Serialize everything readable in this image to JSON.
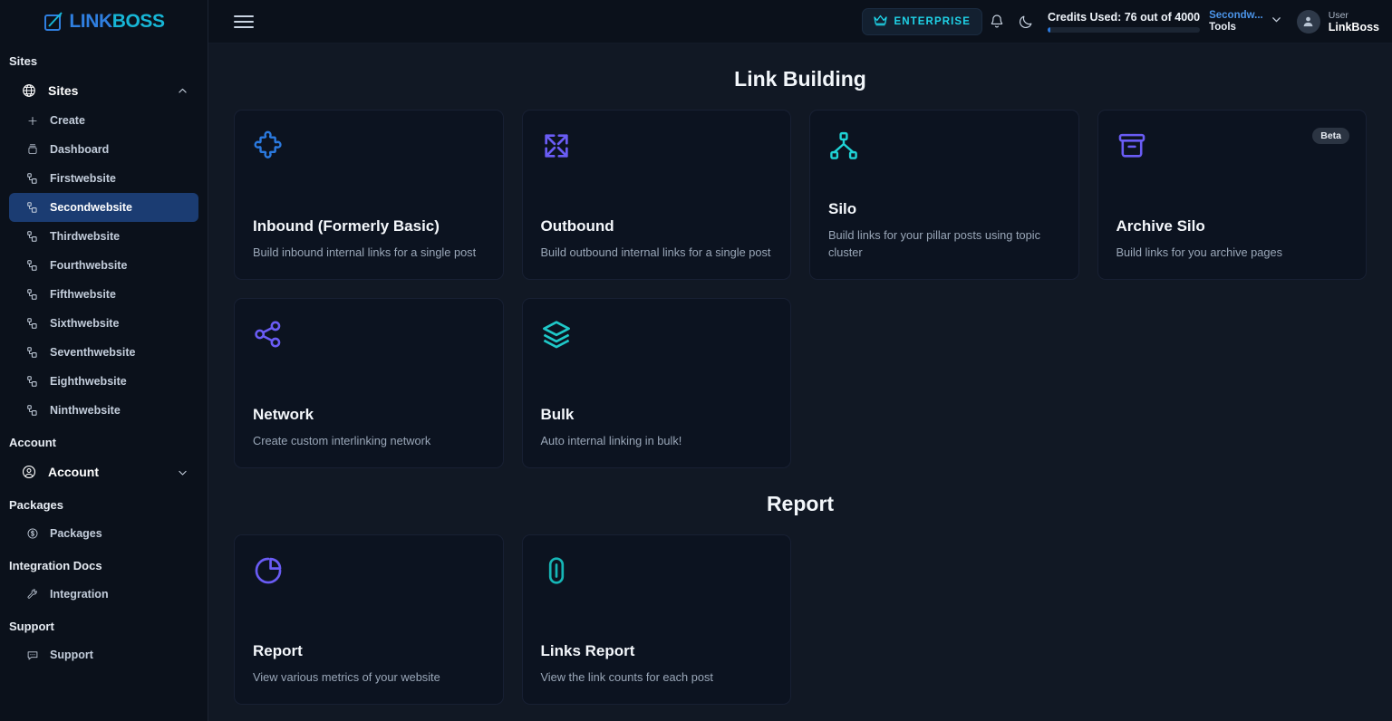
{
  "brand": {
    "name_part1": "LINK",
    "name_part2": "BOSS",
    "logo_icon": "linkboss-logo-icon"
  },
  "topbar": {
    "menu_icon": "hamburger-menu-icon",
    "enterprise_badge": {
      "label": "ENTERPRISE",
      "icon": "crown-icon",
      "color": "#1fd3e8"
    },
    "notification_icon": "bell-icon",
    "theme_icon": "moon-icon",
    "credits": {
      "label": "Credits Used: 76 out of 4000",
      "used": 76,
      "total": 4000,
      "percent": 1.9
    },
    "site_switcher": {
      "site": "Secondw...",
      "sub": "Tools",
      "chevron_icon": "chevron-down-icon"
    },
    "user": {
      "role": "User",
      "name": "LinkBoss",
      "avatar_icon": "user-avatar-icon"
    }
  },
  "sidebar": {
    "groups": [
      {
        "title": "Sites",
        "items": [
          {
            "label": "Sites",
            "icon": "globe-icon",
            "type": "parent",
            "expanded": true,
            "chevron": "chevron-up-icon"
          },
          {
            "label": "Create",
            "icon": "plus-icon",
            "type": "sub"
          },
          {
            "label": "Dashboard",
            "icon": "dashboard-icon",
            "type": "sub"
          },
          {
            "label": "Firstwebsite",
            "icon": "sitemap-icon",
            "type": "sub"
          },
          {
            "label": "Secondwebsite",
            "icon": "sitemap-icon",
            "type": "sub",
            "active": true
          },
          {
            "label": "Thirdwebsite",
            "icon": "sitemap-icon",
            "type": "sub"
          },
          {
            "label": "Fourthwebsite",
            "icon": "sitemap-icon",
            "type": "sub"
          },
          {
            "label": "Fifthwebsite",
            "icon": "sitemap-icon",
            "type": "sub"
          },
          {
            "label": "Sixthwebsite",
            "icon": "sitemap-icon",
            "type": "sub"
          },
          {
            "label": "Seventhwebsite",
            "icon": "sitemap-icon",
            "type": "sub"
          },
          {
            "label": "Eighthwebsite",
            "icon": "sitemap-icon",
            "type": "sub"
          },
          {
            "label": "Ninthwebsite",
            "icon": "sitemap-icon",
            "type": "sub"
          }
        ]
      },
      {
        "title": "Account",
        "items": [
          {
            "label": "Account",
            "icon": "user-circle-icon",
            "type": "parent",
            "expanded": false,
            "chevron": "chevron-down-icon"
          }
        ]
      },
      {
        "title": "Packages",
        "items": [
          {
            "label": "Packages",
            "icon": "dollar-circle-icon",
            "type": "sub"
          }
        ]
      },
      {
        "title": "Integration Docs",
        "items": [
          {
            "label": "Integration",
            "icon": "wrench-icon",
            "type": "sub"
          }
        ]
      },
      {
        "title": "Support",
        "items": [
          {
            "label": "Support",
            "icon": "chat-icon",
            "type": "sub"
          }
        ]
      }
    ]
  },
  "main": {
    "sections": [
      {
        "title": "Link Building",
        "cards": [
          {
            "title": "Inbound (Formerly Basic)",
            "desc": "Build inbound internal links for a single post",
            "icon": "puzzle-icon",
            "color": "#2b7ae0"
          },
          {
            "title": "Outbound",
            "desc": "Build outbound internal links for a single post",
            "icon": "expand-arrows-icon",
            "color": "#6a5cf5"
          },
          {
            "title": "Silo",
            "desc": "Build links for your pillar posts using topic cluster",
            "icon": "hierarchy-icon",
            "color": "#1fd3d6"
          },
          {
            "title": "Archive Silo",
            "desc": "Build links for you archive pages",
            "icon": "archive-box-icon",
            "color": "#6a5cf5",
            "badge": "Beta"
          },
          {
            "title": "Network",
            "desc": "Create custom interlinking network",
            "icon": "share-nodes-icon",
            "color": "#6a5cf5"
          },
          {
            "title": "Bulk",
            "desc": "Auto internal linking in bulk!",
            "icon": "layers-icon",
            "color": "#1fc8c8"
          }
        ]
      },
      {
        "title": "Report",
        "cards": [
          {
            "title": "Report",
            "desc": "View various metrics of your website",
            "icon": "pie-chart-icon",
            "color": "#6a5cf5"
          },
          {
            "title": "Links Report",
            "desc": "View the link counts for each post",
            "icon": "link-icon",
            "color": "#16b6b6"
          }
        ]
      }
    ]
  }
}
